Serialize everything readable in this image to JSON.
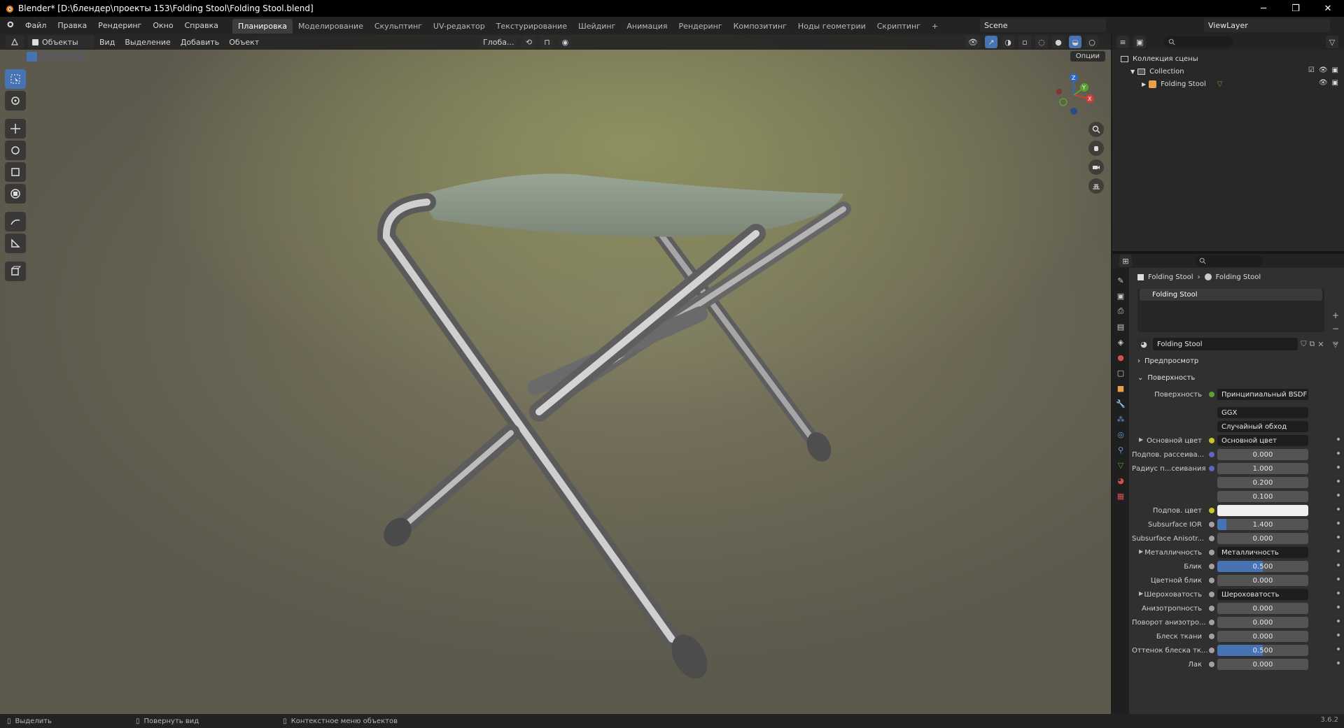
{
  "window": {
    "title": "Blender* [D:\\блендер\\проекты 153\\Folding Stool\\Folding Stool.blend]",
    "minimize": "─",
    "maximize": "❐",
    "close": "✕"
  },
  "menu": {
    "items": [
      "Файл",
      "Правка",
      "Рендеринг",
      "Окно",
      "Справка"
    ],
    "workspaces": [
      "Планировка",
      "Моделирование",
      "Скульптинг",
      "UV-редактор",
      "Текстурирование",
      "Шейдинг",
      "Анимация",
      "Рендеринг",
      "Композитинг",
      "Ноды геометрии",
      "Скриптинг"
    ],
    "add_workspace": "+",
    "scene": "Scene",
    "view_layer": "ViewLayer"
  },
  "viewport": {
    "mode": "Объекты",
    "menus": [
      "Вид",
      "Выделение",
      "Добавить",
      "Объект"
    ],
    "orientation": "Глоба...",
    "options": "Опции"
  },
  "outliner": {
    "scene_collection": "Коллекция сцены",
    "collection": "Collection",
    "object": "Folding Stool"
  },
  "properties": {
    "breadcrumb_object": "Folding Stool",
    "breadcrumb_material": "Folding Stool",
    "slot": "Folding Stool",
    "material_name": "Folding Stool",
    "panel_preview": "Предпросмотр",
    "panel_surface": "Поверхность",
    "surface_label": "Поверхность",
    "surface_value": "Принципиальный BSDF",
    "distribution": "GGX",
    "subsurface_method": "Случайный обход",
    "rows": [
      {
        "label": "Основной цвет",
        "value": "Основной цвет",
        "kind": "link",
        "dot": "#c7c729",
        "expander": true
      },
      {
        "label": "Подпов. рассеива...",
        "value": "0.000",
        "kind": "num",
        "dot": "#6363c7",
        "fill": 0
      },
      {
        "label": "Радиус п...сеивания",
        "value": "1.000",
        "kind": "num",
        "dot": "#6363c7",
        "fill": 0
      },
      {
        "label": "",
        "value": "0.200",
        "kind": "num",
        "dot": "",
        "fill": 0
      },
      {
        "label": "",
        "value": "0.100",
        "kind": "num",
        "dot": "",
        "fill": 0
      },
      {
        "label": "Подпов. цвет",
        "value": "",
        "kind": "color",
        "dot": "#c7c729",
        "fill": 0
      },
      {
        "label": "Subsurface IOR",
        "value": "1.400",
        "kind": "num",
        "dot": "#a1a1a1",
        "fill": 0.1
      },
      {
        "label": "Subsurface Anisotr...",
        "value": "0.000",
        "kind": "num",
        "dot": "#a1a1a1",
        "fill": 0
      },
      {
        "label": "Металличность",
        "value": "Металличность",
        "kind": "link",
        "dot": "#a1a1a1",
        "expander": true
      },
      {
        "label": "Блик",
        "value": "0.500",
        "kind": "num",
        "dot": "#a1a1a1",
        "fill": 0.5
      },
      {
        "label": "Цветной блик",
        "value": "0.000",
        "kind": "num",
        "dot": "#a1a1a1",
        "fill": 0
      },
      {
        "label": "Шероховатость",
        "value": "Шероховатость",
        "kind": "link",
        "dot": "#a1a1a1",
        "expander": true
      },
      {
        "label": "Анизотропность",
        "value": "0.000",
        "kind": "num",
        "dot": "#a1a1a1",
        "fill": 0
      },
      {
        "label": "Поворот анизотро...",
        "value": "0.000",
        "kind": "num",
        "dot": "#a1a1a1",
        "fill": 0
      },
      {
        "label": "Блеск ткани",
        "value": "0.000",
        "kind": "num",
        "dot": "#a1a1a1",
        "fill": 0
      },
      {
        "label": "Оттенок блеска тк...",
        "value": "0.500",
        "kind": "num",
        "dot": "#a1a1a1",
        "fill": 0.5
      },
      {
        "label": "Лак",
        "value": "0.000",
        "kind": "num",
        "dot": "#a1a1a1",
        "fill": 0
      }
    ]
  },
  "status": {
    "select": "Выделить",
    "rotate": "Повернуть вид",
    "context": "Контекстное меню объектов",
    "version": "3.6.2"
  },
  "colors": {
    "accent": "#4772b3",
    "background": "#303030"
  }
}
